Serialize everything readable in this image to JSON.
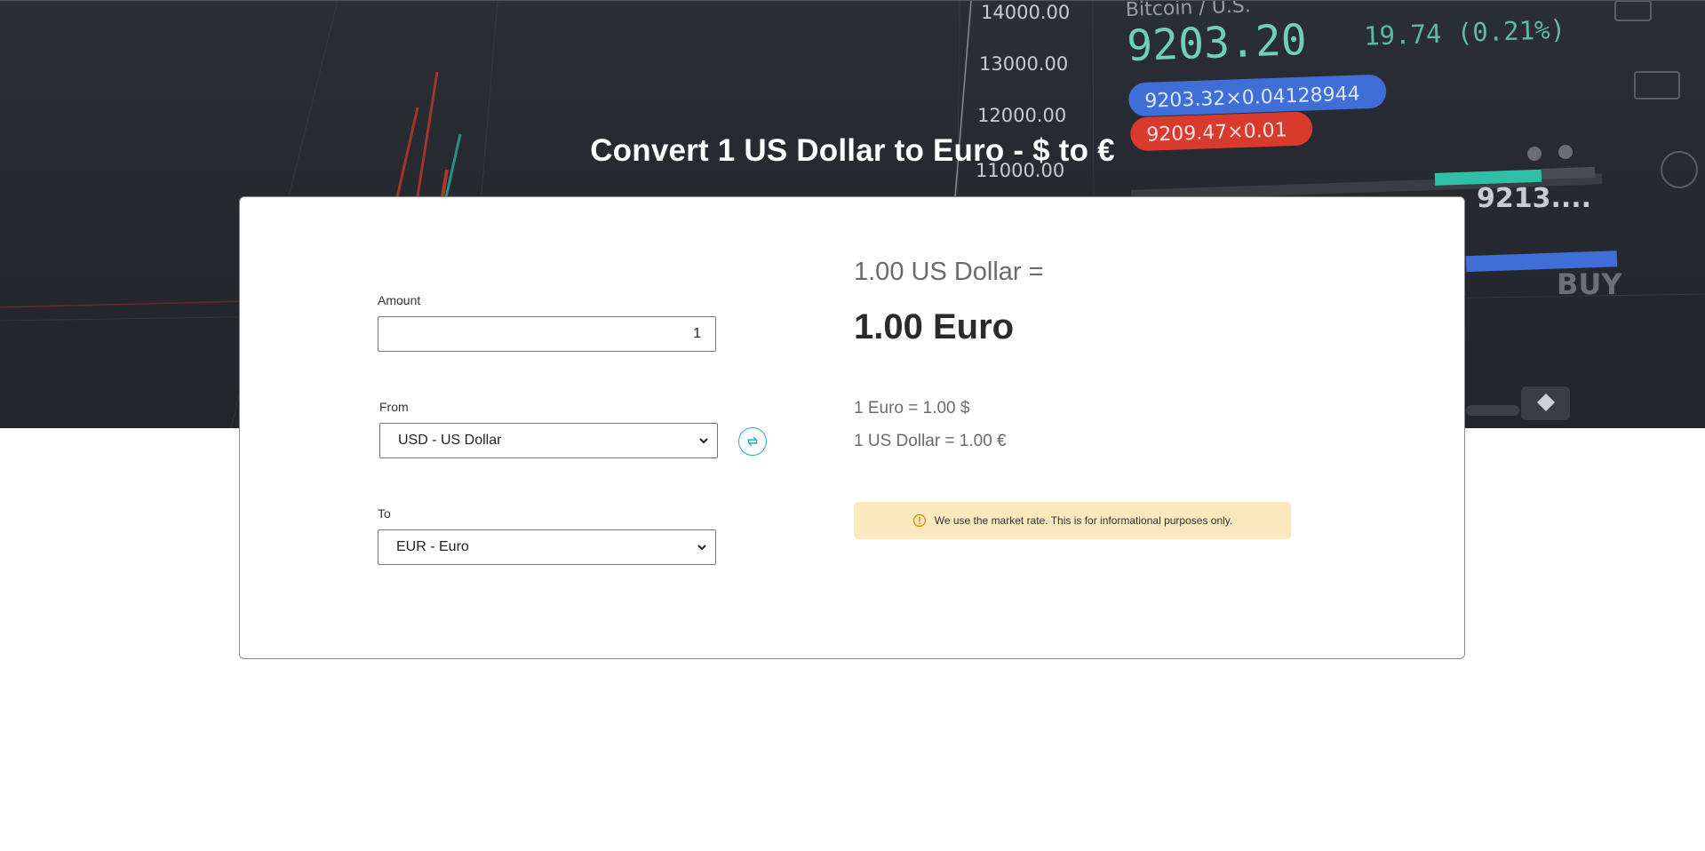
{
  "page": {
    "title": "Convert 1 US Dollar to Euro - $ to €"
  },
  "hero": {
    "price_axis": [
      "14000.00",
      "13000.00",
      "12000.00",
      "11000.00"
    ],
    "ticker_name": "Bitcoin / U.S.",
    "ticker_price": "9203.20",
    "ticker_change": "19.74 (0.21%)",
    "bid": "9203.32×0.04128944",
    "ask": "9209.47×0.01",
    "book_price": "9213....",
    "buy_label": "BUY"
  },
  "converter": {
    "amount_label": "Amount",
    "amount_value": "1",
    "from_label": "From",
    "from_selected": "USD - US Dollar",
    "to_label": "To",
    "to_selected": "EUR - Euro",
    "swap_icon": "swap-icon"
  },
  "result": {
    "from_text": "1.00 US Dollar =",
    "to_text": "1.00 Euro",
    "rate_reverse": "1 Euro = 1.00 $",
    "rate_forward": "1 US Dollar = 1.00 €",
    "notice": "We use the market rate. This is for informational purposes only.",
    "notice_icon": "warning-icon"
  },
  "colors": {
    "accent": "#1fa9d6",
    "notice_bg": "#fbe8bd",
    "notice_icon": "#d48a00",
    "hero_bg": "#262930"
  }
}
